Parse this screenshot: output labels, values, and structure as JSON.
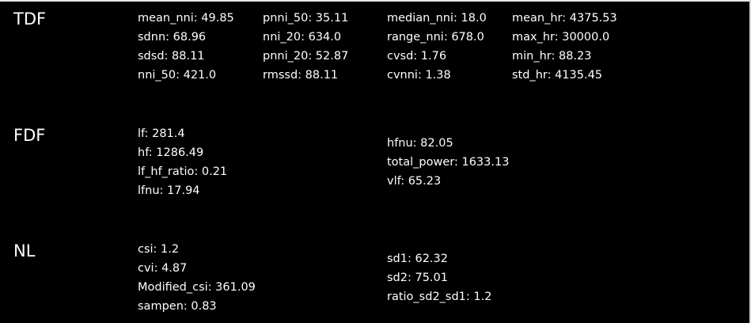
{
  "sections": {
    "tdf": {
      "title": "TDF",
      "col1": [
        "mean_nni: 49.85",
        "sdnn: 68.96",
        "sdsd: 88.11",
        "nni_50: 421.0"
      ],
      "col2": [
        "pnni_50: 35.11",
        "nni_20: 634.0",
        "pnni_20: 52.87",
        "rmssd: 88.11"
      ],
      "col3": [
        "median_nni: 18.0",
        "range_nni: 678.0",
        "cvsd: 1.76",
        "cvnni: 1.38"
      ],
      "col4": [
        "mean_hr: 4375.53",
        "max_hr: 30000.0",
        "min_hr: 88.23",
        "std_hr: 4135.45"
      ]
    },
    "fdf": {
      "title": "FDF",
      "col1": [
        "lf: 281.4",
        "hf: 1286.49",
        "lf_hf_ratio: 0.21",
        "lfnu: 17.94"
      ],
      "col2": [
        "hfnu: 82.05",
        "total_power: 1633.13",
        "vlf: 65.23"
      ]
    },
    "nl": {
      "title": "NL",
      "col1": [
        "csi: 1.2",
        "cvi: 4.87",
        "Modified_csi: 361.09",
        "sampen: 0.83"
      ],
      "col2": [
        "sd1: 62.32",
        "sd2: 75.01",
        "ratio_sd2_sd1: 1.2"
      ]
    }
  }
}
